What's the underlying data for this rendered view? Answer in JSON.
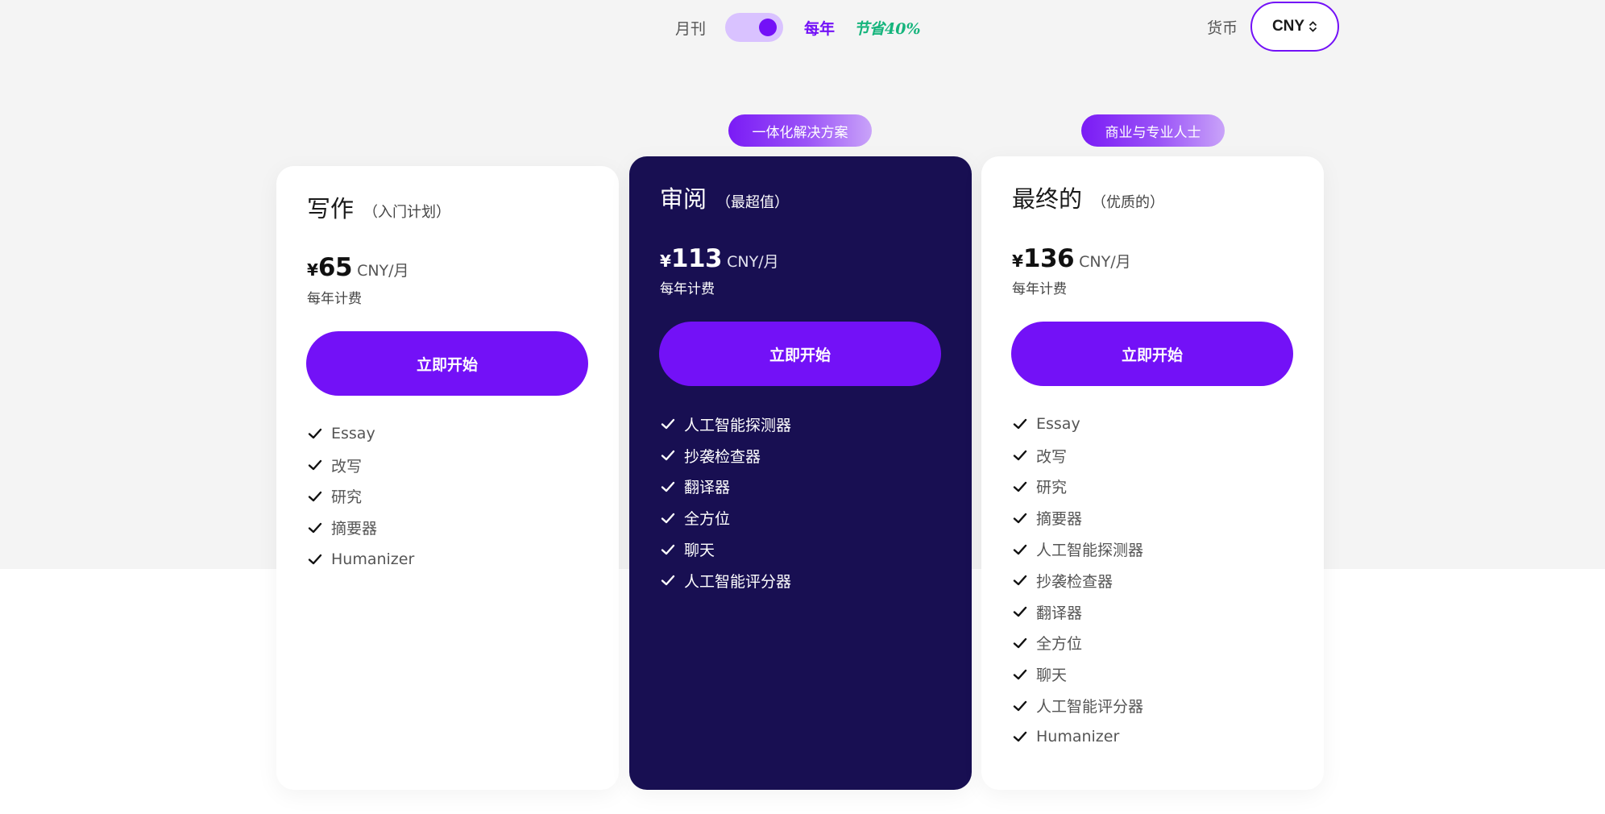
{
  "billing": {
    "monthly_label": "月刊",
    "yearly_label": "每年",
    "save_label": "节省40%",
    "yearly_selected": true
  },
  "currency": {
    "label": "货币",
    "selected": "CNY"
  },
  "colors": {
    "accent": "#7311f7",
    "dark_card": "#180f52",
    "save_green": "#15b47c"
  },
  "plans": [
    {
      "name": "写作",
      "subtitle": "（入门计划）",
      "currency_symbol": "¥",
      "price": "65",
      "unit": "CNY/月",
      "billed": "每年计费",
      "cta": "立即开始",
      "features": [
        "Essay",
        "改写",
        "研究",
        "摘要器",
        "Humanizer"
      ]
    },
    {
      "badge": "一体化解决方案",
      "name": "审阅",
      "subtitle": "（最超值）",
      "currency_symbol": "¥",
      "price": "113",
      "unit": "CNY/月",
      "billed": "每年计费",
      "cta": "立即开始",
      "features": [
        "人工智能探测器",
        "抄袭检查器",
        "翻译器",
        "全方位",
        "聊天",
        "人工智能评分器"
      ]
    },
    {
      "badge": "商业与专业人士",
      "name": "最终的",
      "subtitle": "（优质的）",
      "currency_symbol": "¥",
      "price": "136",
      "unit": "CNY/月",
      "billed": "每年计费",
      "cta": "立即开始",
      "features": [
        "Essay",
        "改写",
        "研究",
        "摘要器",
        "人工智能探测器",
        "抄袭检查器",
        "翻译器",
        "全方位",
        "聊天",
        "人工智能评分器",
        "Humanizer"
      ]
    }
  ]
}
